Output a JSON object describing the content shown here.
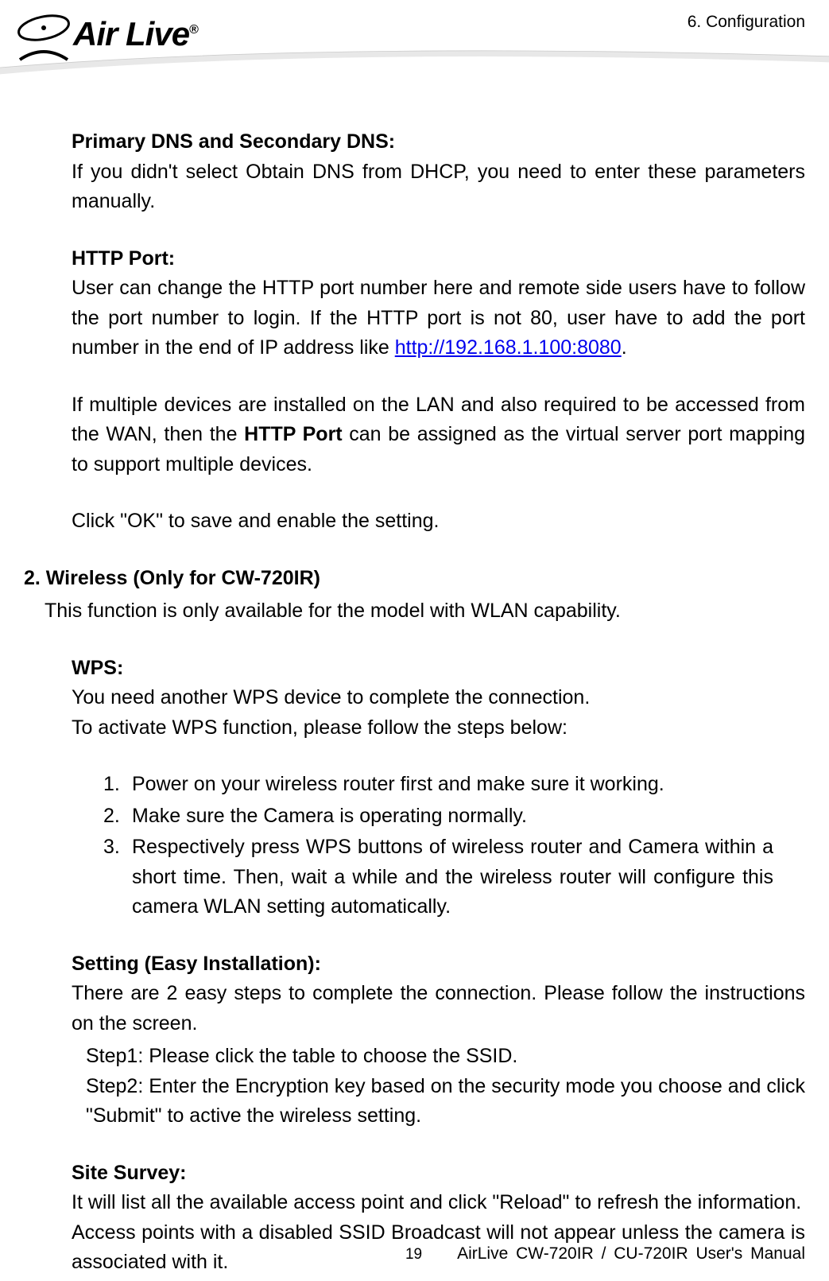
{
  "header": {
    "logo_brand": "Air Live",
    "logo_reg": "®",
    "chapter": "6. Configuration"
  },
  "dns": {
    "title": "Primary DNS and Secondary DNS:",
    "body": "If you didn't select Obtain DNS from DHCP, you need to enter these parameters manually."
  },
  "http_port": {
    "title": "HTTP Port:",
    "p1_pre": "User can change the HTTP port number here and remote side users have to follow the port number to login. If the HTTP port is not 80, user have to add the port number in the end of IP address like ",
    "link": "http://192.168.1.100:8080",
    "p1_post": ".",
    "p2_pre": "If multiple devices are installed on the LAN and also required to be accessed from the WAN, then the ",
    "p2_bold": "HTTP Port",
    "p2_post": " can be assigned as the virtual server port mapping to support multiple devices.",
    "p3": "Click \"OK\" to save and enable the setting."
  },
  "wireless": {
    "heading": "2.  Wireless (Only for CW-720IR)",
    "intro": "This function is only available for the model with WLAN capability."
  },
  "wps": {
    "title": "WPS:",
    "line1": "You need another WPS device to complete the connection.",
    "line2": "To activate WPS function, please follow the steps below:",
    "steps": {
      "n1": "1.",
      "s1": "Power on your wireless router first and make sure it working.",
      "n2": "2.",
      "s2": "Make sure the Camera is operating normally.",
      "n3": "3.",
      "s3": "Respectively press WPS buttons of wireless router and Camera within a short time. Then, wait a while and the wireless router will configure this camera WLAN setting automatically."
    }
  },
  "setting": {
    "title": "Setting (Easy Installation):",
    "intro": "There are 2 easy steps to complete the connection. Please follow the instructions on the screen.",
    "step1": "Step1: Please click the table to choose the SSID.",
    "step2": "Step2: Enter the Encryption key based on the security mode you choose and click \"Submit\" to active the wireless setting."
  },
  "survey": {
    "title": "Site Survey:",
    "line1": "It will list all the available access point and click \"Reload\" to refresh the information.",
    "line2": "Access points with a disabled SSID Broadcast will not appear unless the camera is associated with it."
  },
  "footer": {
    "page": "19",
    "manual": "AirLive CW-720IR / CU-720IR User's Manual"
  }
}
